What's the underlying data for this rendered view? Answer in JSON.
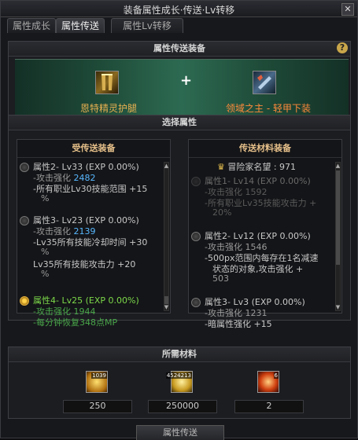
{
  "window": {
    "title": "装备属性成长·传送·Lv转移"
  },
  "tabs": [
    {
      "label": "属性成长"
    },
    {
      "label": "属性传送"
    },
    {
      "label": "属性Lv转移"
    }
  ],
  "transfer_section": {
    "header": "属性传送装备",
    "source_item": "恩特精灵护腿",
    "target_item": "领域之主 - 轻甲下装",
    "plus": "+"
  },
  "select_section": {
    "header": "选择属性",
    "left_header": "受传送装备",
    "right_header": "传送材料装备",
    "adventurer_fame": "冒险家名望 : 971",
    "left_options": [
      {
        "title": "属性2- Lv33 (EXP 0.00%)",
        "lines": [
          "-攻击强化 2482",
          "-所有职业Lv30技能范围 +15",
          "%"
        ]
      },
      {
        "title": "属性3- Lv23 (EXP 0.00%)",
        "lines": [
          "-攻击强化 2139",
          "-Lv35所有技能冷却时间 +30",
          "%",
          "Lv35所有技能攻击力 +20",
          "%"
        ]
      },
      {
        "title": "属性4- Lv25 (EXP 0.00%)",
        "lines": [
          "-攻击强化 1944",
          "-每分钟恢复348点MP"
        ]
      }
    ],
    "right_options": [
      {
        "title": "属性1- Lv14 (EXP 0.00%)",
        "lines": [
          "-攻击强化 1592",
          "-所有职业Lv35技能攻击力 +",
          "20%"
        ]
      },
      {
        "title": "属性2- Lv12 (EXP 0.00%)",
        "lines": [
          "-攻击强化 1546",
          "-500px范围内每存在1名减速",
          "状态的对象,攻击强化 +",
          "503"
        ]
      },
      {
        "title": "属性3- Lv3 (EXP 0.00%)",
        "lines": [
          "-攻击强化 1231",
          "-暗属性强化 +15"
        ]
      }
    ]
  },
  "materials": {
    "header": "所需材料",
    "items": [
      {
        "icon": "gold-crystal-icon",
        "count": "1039",
        "qty": "250"
      },
      {
        "icon": "gold-coins-icon",
        "count": "4524213",
        "qty": "250000"
      },
      {
        "icon": "fire-stone-icon",
        "count": "6",
        "qty": "2"
      }
    ]
  },
  "bottom_button": {
    "label": "属性传送"
  }
}
